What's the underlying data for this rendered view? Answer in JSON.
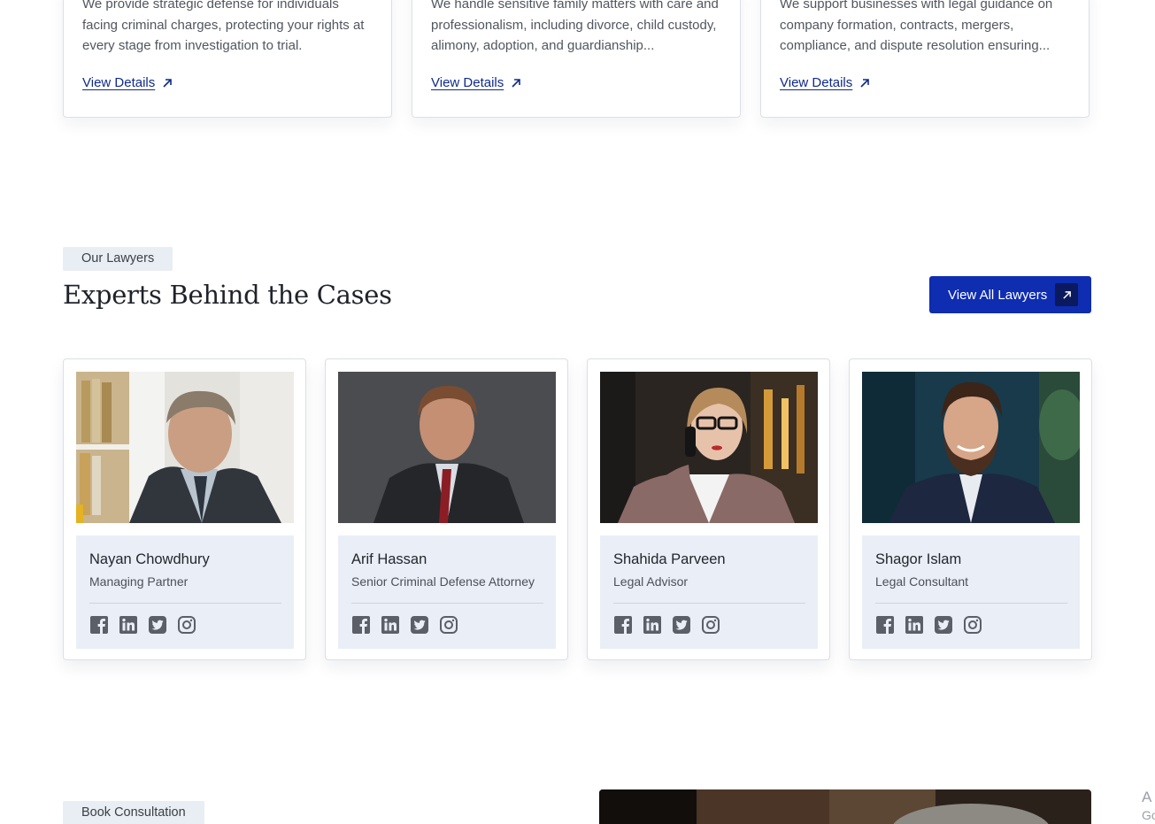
{
  "practice_cards": [
    {
      "description": "We provide strategic defense for individuals facing criminal charges, protecting your rights at every stage from investigation to trial.",
      "link_label": "View Details"
    },
    {
      "description": "We handle sensitive family matters with care and professionalism, including divorce, child custody, alimony, adoption, and guardianship...",
      "link_label": "View Details"
    },
    {
      "description": "We support businesses with legal guidance on company formation, contracts, mergers, compliance, and dispute resolution ensuring...",
      "link_label": "View Details"
    }
  ],
  "lawyers_section": {
    "tag": "Our Lawyers",
    "heading": "Experts Behind the Cases",
    "view_all_label": "View All Lawyers"
  },
  "lawyers": [
    {
      "name": "Nayan Chowdhury",
      "role": "Managing Partner"
    },
    {
      "name": "Arif Hassan",
      "role": "Senior Criminal Defense Attorney"
    },
    {
      "name": "Shahida Parveen",
      "role": "Legal Advisor"
    },
    {
      "name": "Shagor Islam",
      "role": "Legal Consultant"
    }
  ],
  "social_icons": [
    "facebook-icon",
    "linkedin-icon",
    "twitter-icon",
    "instagram-icon"
  ],
  "consultation_section": {
    "tag": "Book Consultation"
  },
  "edge_fragments": {
    "top": "A",
    "bottom": "Go"
  },
  "colors": {
    "brand_blue": "#0e2db1",
    "link_blue": "#0f2a8a",
    "tag_bg": "#e9edf4",
    "card_info_bg": "#eaeef6",
    "icon_gray": "#5a5f68"
  }
}
